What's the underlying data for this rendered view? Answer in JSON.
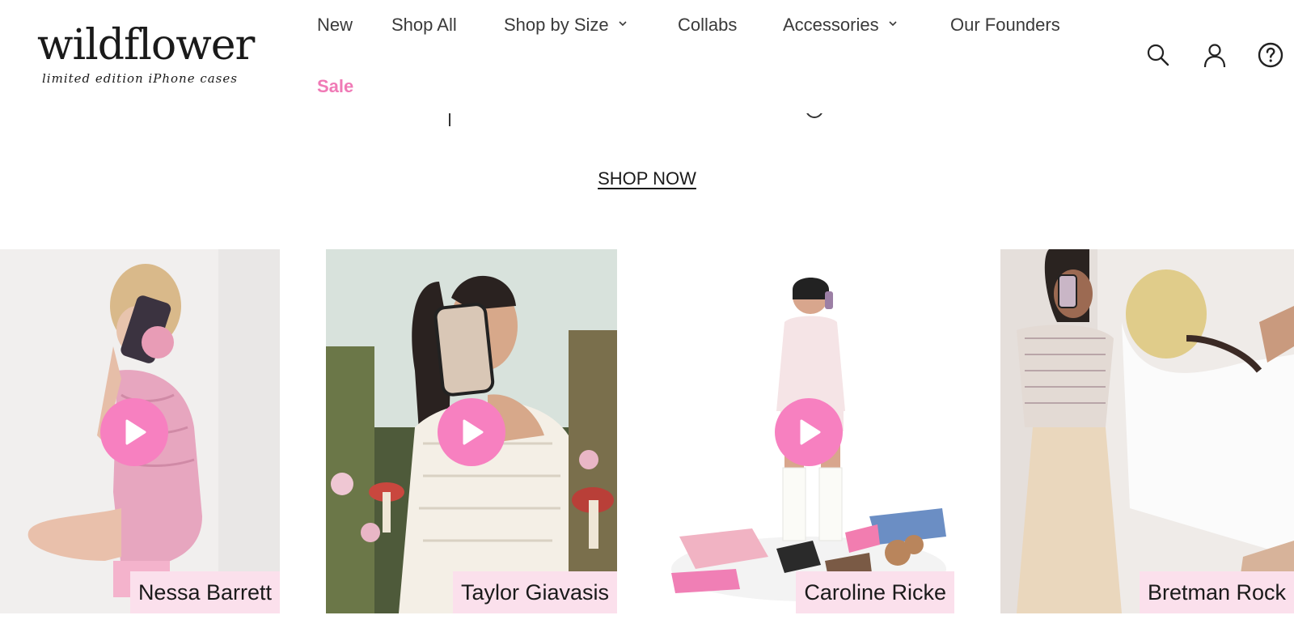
{
  "logo": {
    "name": "wildflower",
    "tagline": "limited edition iPhone cases"
  },
  "nav": {
    "items": [
      {
        "label": "New"
      },
      {
        "label": "Shop All"
      },
      {
        "label": "Shop by Size"
      },
      {
        "label": "Collabs"
      },
      {
        "label": "Accessories"
      },
      {
        "label": "Our Founders"
      },
      {
        "label": "Sale"
      }
    ]
  },
  "header_icons": [
    "search-icon",
    "account-icon",
    "help-icon"
  ],
  "hero": {
    "cta_label": "SHOP NOW"
  },
  "creators": [
    {
      "name": "Nessa Barrett",
      "has_video": true
    },
    {
      "name": "Taylor Giavasis",
      "has_video": true
    },
    {
      "name": "Caroline Ricke",
      "has_video": true
    },
    {
      "name": "Bretman Rock",
      "has_video": false
    }
  ],
  "colors": {
    "accent_pink": "#f780c0",
    "sale_pink": "#f07ab6",
    "label_bg": "#fbe0ec"
  }
}
